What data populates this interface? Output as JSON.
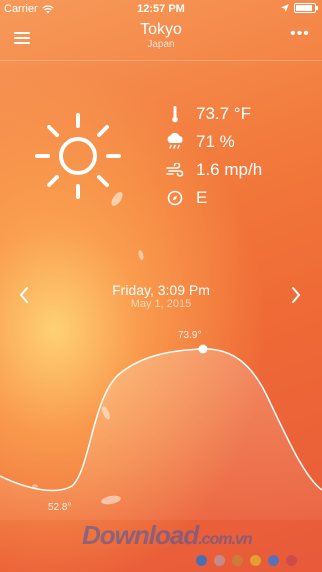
{
  "status": {
    "carrier": "Carrier",
    "time": "12:57 PM"
  },
  "header": {
    "city": "Tokyo",
    "country": "Japan"
  },
  "weather": {
    "icon": "sun-icon",
    "temperature": "73.7 °F",
    "humidity": "71 %",
    "wind_speed": "1.6 mp/h",
    "wind_direction": "E"
  },
  "date": {
    "main": "Friday, 3:09 Pm",
    "sub": "May 1, 2015"
  },
  "graph": {
    "max_label": "73.9°",
    "min_label": "52.8°"
  },
  "watermark": {
    "text": "Download",
    "domain": ".com.vn",
    "dot_colors": [
      "#4a6fb0",
      "#c58a8a",
      "#d07a3a",
      "#e3a030",
      "#5a72b5",
      "#d04a4a"
    ]
  }
}
